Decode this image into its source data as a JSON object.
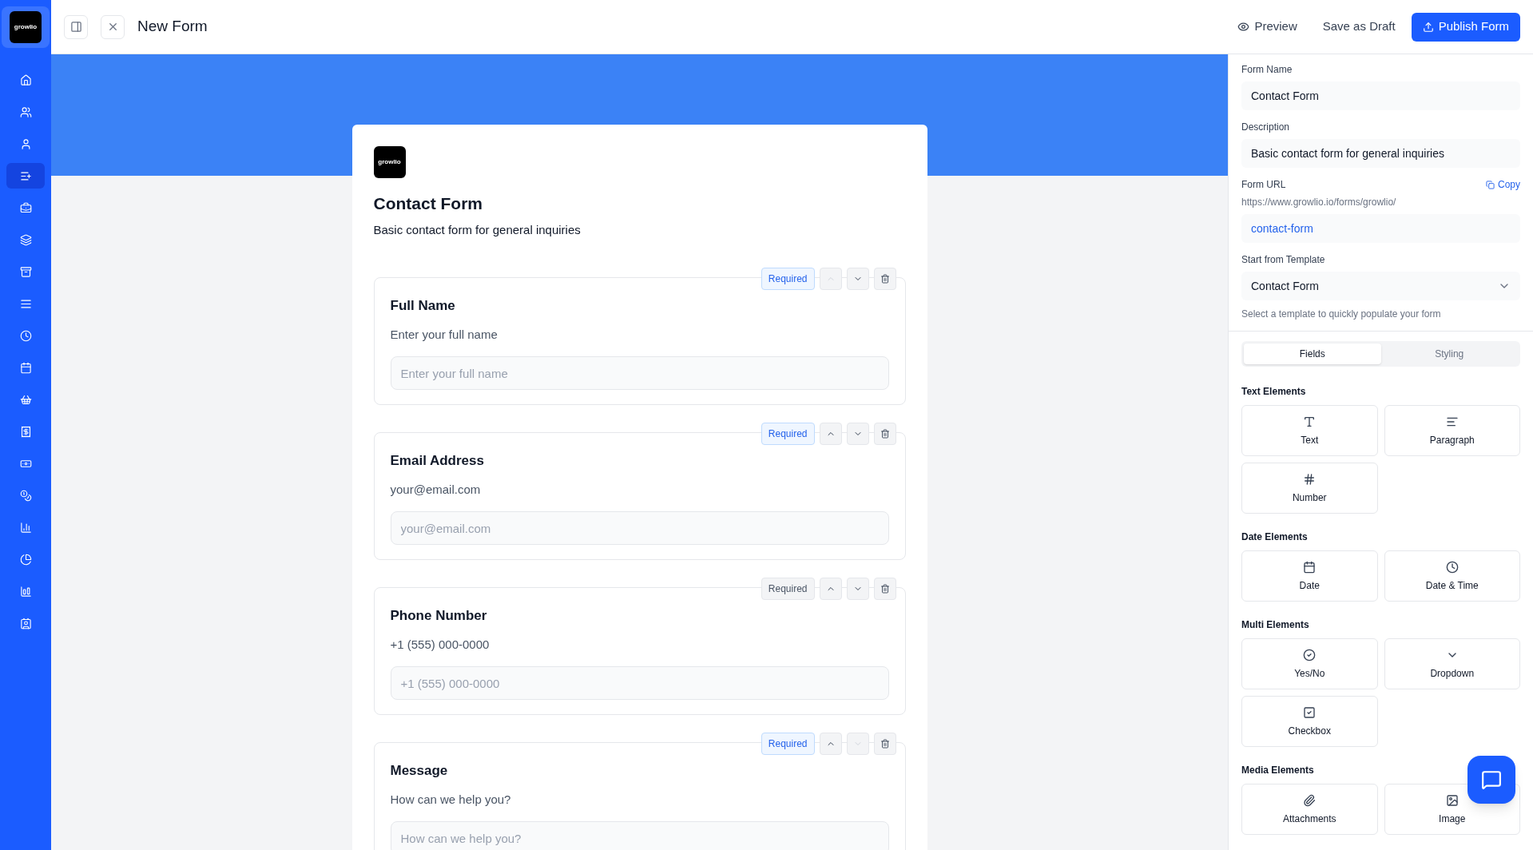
{
  "brand": {
    "logo_text": "growlio"
  },
  "sidebar": {
    "items": [
      {
        "kind": "home",
        "selected": false
      },
      {
        "kind": "users",
        "selected": false
      },
      {
        "kind": "user",
        "selected": false
      },
      {
        "kind": "list-plus",
        "selected": true
      },
      {
        "kind": "briefcase",
        "selected": false
      },
      {
        "kind": "layers",
        "selected": false
      },
      {
        "kind": "archive",
        "selected": false
      },
      {
        "kind": "lines",
        "selected": false
      },
      {
        "kind": "clock",
        "selected": false
      },
      {
        "kind": "calendar",
        "selected": false
      },
      {
        "kind": "basket",
        "selected": false
      },
      {
        "kind": "receipt",
        "selected": false
      },
      {
        "kind": "banknote",
        "selected": false
      },
      {
        "kind": "coins",
        "selected": false
      },
      {
        "kind": "chart",
        "selected": false
      },
      {
        "kind": "pie",
        "selected": false
      },
      {
        "kind": "chart-big",
        "selected": false
      },
      {
        "kind": "contact",
        "selected": false
      }
    ]
  },
  "header": {
    "title": "New Form",
    "actions": [
      {
        "kind": "preview",
        "label": "Preview"
      },
      {
        "kind": "draft",
        "label": "Save as Draft"
      },
      {
        "kind": "publish",
        "label": "Publish Form"
      }
    ]
  },
  "form": {
    "logo_text": "growlio",
    "title": "Contact Form",
    "description": "Basic contact form for general inquiries",
    "fields": [
      {
        "label": "Full Name",
        "description": "Enter your full name",
        "placeholder": "Enter your full name",
        "required_label": "Required",
        "required": true,
        "can_move_up": false,
        "can_move_down": true
      },
      {
        "label": "Email Address",
        "description": "your@email.com",
        "placeholder": "your@email.com",
        "required_label": "Required",
        "required": true,
        "can_move_up": true,
        "can_move_down": true
      },
      {
        "label": "Phone Number",
        "description": "+1 (555) 000-0000",
        "placeholder": "+1 (555) 000-0000",
        "required_label": "Required",
        "required": false,
        "can_move_up": true,
        "can_move_down": true
      },
      {
        "label": "Message",
        "description": "How can we help you?",
        "placeholder": "How can we help you?",
        "required_label": "Required",
        "required": true,
        "can_move_up": true,
        "can_move_down": false
      }
    ]
  },
  "settings": {
    "form_name": {
      "label": "Form Name",
      "value": "Contact Form"
    },
    "description": {
      "label": "Description",
      "value": "Basic contact form for general inquiries"
    },
    "form_url": {
      "label": "Form URL",
      "copy_label": "Copy",
      "base": "https://www.growlio.io/forms/growlio/",
      "slug": "contact-form"
    },
    "template": {
      "label": "Start from Template",
      "value": "Contact Form",
      "hint": "Select a template to quickly populate your form"
    }
  },
  "tabs": [
    {
      "label": "Fields",
      "selected": true
    },
    {
      "label": "Styling",
      "selected": false
    }
  ],
  "palette": [
    {
      "title": "Text Elements",
      "items": [
        {
          "kind": "text",
          "label": "Text"
        },
        {
          "kind": "paragraph",
          "label": "Paragraph"
        },
        {
          "kind": "number",
          "label": "Number"
        }
      ]
    },
    {
      "title": "Date Elements",
      "items": [
        {
          "kind": "date",
          "label": "Date"
        },
        {
          "kind": "datetime",
          "label": "Date & Time"
        }
      ]
    },
    {
      "title": "Multi Elements",
      "items": [
        {
          "kind": "yesno",
          "label": "Yes/No"
        },
        {
          "kind": "dropdown",
          "label": "Dropdown"
        },
        {
          "kind": "checkbox",
          "label": "Checkbox"
        }
      ]
    },
    {
      "title": "Media Elements",
      "items": [
        {
          "kind": "attachment",
          "label": "Attachments"
        },
        {
          "kind": "image",
          "label": "Image"
        }
      ]
    }
  ]
}
